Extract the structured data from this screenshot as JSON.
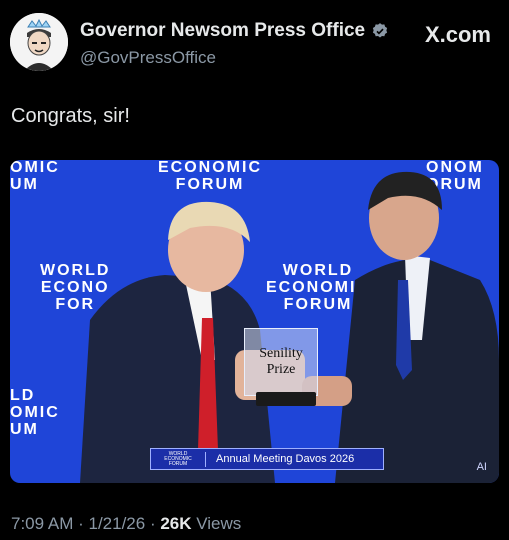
{
  "account": {
    "display_name": "Governor Newsom Press Office",
    "handle": "@GovPressOffice",
    "avatar_icon": "avatar-caricature"
  },
  "brand": "X.com",
  "tweet_text": "Congrats, sir!",
  "media": {
    "banner_labels": {
      "wef_top_center": "ECONOMIC\nFORUM",
      "wef_top_left": "OMIC\nUM",
      "wef_top_right": "ONOM\nORUM",
      "wef_mid_left": "WORLD\nECONO\nFOR",
      "wef_mid_center": "WORLD\nECONOMIC\nFORUM",
      "wef_bottom_left": "LD\nOMIC\nUM"
    },
    "prize_line1": "Senility",
    "prize_line2": "Prize",
    "podium_logo": "WORLD\nECONOMIC\nFORUM",
    "podium_text": "Annual Meeting Davos 2026",
    "ai_label": "AI",
    "background_color": "#1f45d8"
  },
  "meta": {
    "time": "7:09 AM",
    "separator": " · ",
    "date": "1/21/26",
    "views_count": "26K",
    "views_label": " Views"
  }
}
